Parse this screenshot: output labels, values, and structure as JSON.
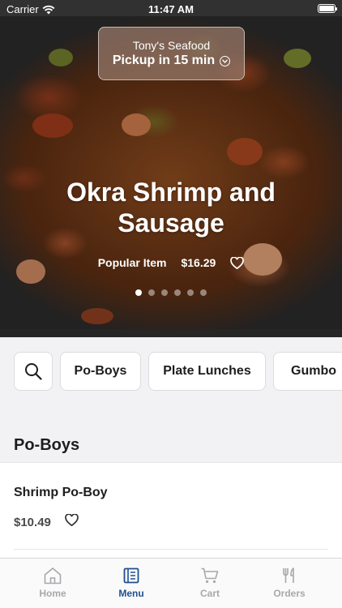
{
  "status_bar": {
    "carrier": "Carrier",
    "time": "11:47 AM"
  },
  "store": {
    "name": "Tony's Seafood",
    "pickup": "Pickup in 15 min"
  },
  "featured": {
    "title": "Okra Shrimp and Sausage",
    "badge": "Popular Item",
    "price": "$16.29",
    "slide_count": 6,
    "active_slide": 1
  },
  "categories": [
    "Po-Boys",
    "Plate Lunches",
    "Gumbo"
  ],
  "menu": {
    "section_title": "Po-Boys",
    "items": [
      {
        "name": "Shrimp Po-Boy",
        "price": "$10.49"
      }
    ]
  },
  "tabs": [
    {
      "label": "Home",
      "icon": "home-icon"
    },
    {
      "label": "Menu",
      "icon": "menu-icon"
    },
    {
      "label": "Cart",
      "icon": "cart-icon"
    },
    {
      "label": "Orders",
      "icon": "fork-knife-icon"
    }
  ],
  "active_tab": "Menu",
  "colors": {
    "accent": "#1f4f8f",
    "tab_inactive": "#a8a8ad"
  }
}
